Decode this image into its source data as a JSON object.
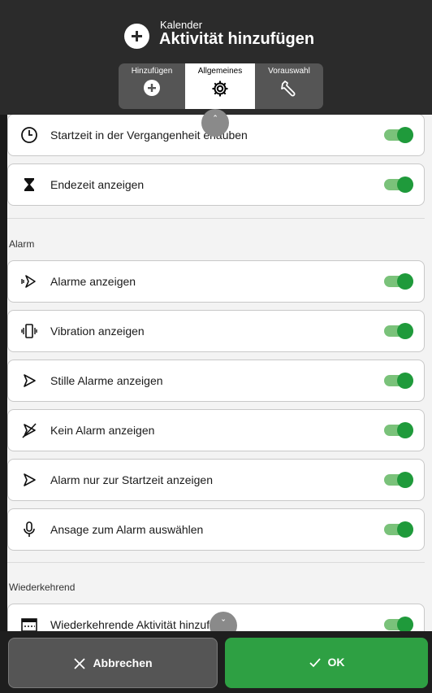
{
  "header": {
    "subtitle": "Kalender",
    "title": "Aktivität hinzufügen",
    "tabs": [
      {
        "label": "Hinzufügen",
        "icon": "plus-circle-icon"
      },
      {
        "label": "Allgemeines",
        "icon": "gear-icon",
        "selected": true
      },
      {
        "label": "Vorauswahl",
        "icon": "wrench-icon"
      }
    ]
  },
  "settings": {
    "top_items": [
      {
        "label": "Startzeit in der Vergangenheit erlauben",
        "icon": "clock-icon",
        "enabled": true
      },
      {
        "label": "Endezeit anzeigen",
        "icon": "hourglass-icon",
        "enabled": true
      }
    ],
    "alarm_section": {
      "title": "Alarm",
      "items": [
        {
          "label": "Alarme anzeigen",
          "icon": "alarm-sound-icon",
          "enabled": true
        },
        {
          "label": "Vibration anzeigen",
          "icon": "vibration-icon",
          "enabled": true
        },
        {
          "label": "Stille Alarme anzeigen",
          "icon": "silent-alarm-icon",
          "enabled": true
        },
        {
          "label": "Kein Alarm anzeigen",
          "icon": "no-alarm-icon",
          "enabled": true
        },
        {
          "label": "Alarm nur zur Startzeit anzeigen",
          "icon": "alarm-start-icon",
          "enabled": true
        },
        {
          "label": "Ansage zum Alarm auswählen",
          "icon": "microphone-icon",
          "enabled": true
        }
      ]
    },
    "recurring_section": {
      "title": "Wiederkehrend",
      "items": [
        {
          "label": "Wiederkehrende Aktivität hinzufügen",
          "icon": "calendar-icon",
          "enabled": true
        }
      ]
    }
  },
  "footer": {
    "cancel_label": "Abbrechen",
    "ok_label": "OK"
  },
  "colors": {
    "accent_green": "#2ea043",
    "toggle_knob": "#1f9a3b",
    "toggle_track": "#7ac27a",
    "header_bg": "#2b2b2b"
  }
}
